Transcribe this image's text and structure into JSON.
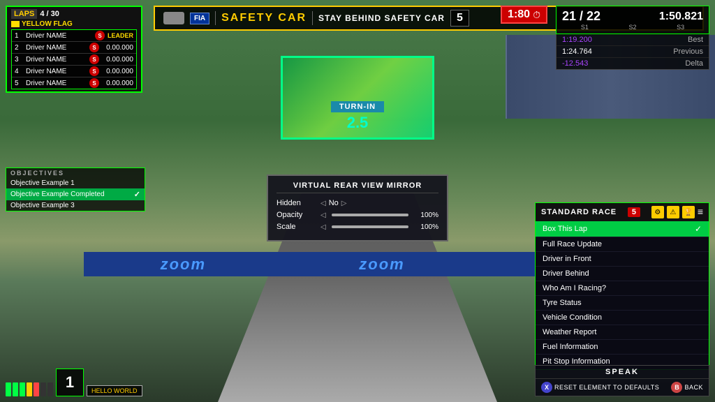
{
  "background": {
    "color": "#2a4a2a"
  },
  "timer": {
    "value": "1:80",
    "icon": "⏱"
  },
  "laps": {
    "label": "LAPS",
    "current": "4",
    "total": "30",
    "display": "4 / 30",
    "flag": "YELLOW FLAG"
  },
  "standings": [
    {
      "pos": "1",
      "name": "Driver NAME",
      "gap": "LEADER",
      "is_leader": true
    },
    {
      "pos": "2",
      "name": "Driver NAME",
      "gap": "0.00.000"
    },
    {
      "pos": "3",
      "name": "Driver NAME",
      "gap": "0.00.000"
    },
    {
      "pos": "4",
      "name": "Driver NAME",
      "gap": "0.00.000"
    },
    {
      "pos": "5",
      "name": "Driver NAME",
      "gap": "0.00.000"
    }
  ],
  "safety_car": {
    "fia": "FIA",
    "title": "SAFETY CAR",
    "instruction": "STAY BEHIND SAFETY CAR",
    "lap_num": "5"
  },
  "timing": {
    "position": "21 / 22",
    "lap_time": "1:50.821",
    "s1": "S1",
    "s2": "S2",
    "s3": "S3",
    "best": "1:19.200",
    "best_label": "Best",
    "previous": "1:24.764",
    "previous_label": "Previous",
    "delta": "-12.543",
    "delta_label": "Delta"
  },
  "turn_in": {
    "label": "TURN-IN",
    "value": "2.5"
  },
  "objectives": {
    "header": "OBJECTIVES",
    "items": [
      {
        "text": "Objective Example 1",
        "completed": false
      },
      {
        "text": "Objective Example Completed",
        "completed": true
      },
      {
        "text": "Objective Example 3",
        "completed": false
      }
    ]
  },
  "mirror_popup": {
    "title": "VIRTUAL REAR VIEW MIRROR",
    "hidden_label": "Hidden",
    "hidden_toggle": "<>",
    "hidden_value": "No",
    "opacity_label": "Opacity",
    "opacity_pct": "100%",
    "scale_label": "Scale",
    "scale_pct": "100%"
  },
  "race_panel": {
    "title": "STANDARD RACE",
    "badge": "5",
    "menu_items": [
      {
        "text": "Box This Lap",
        "active": true
      },
      {
        "text": "Full Race Update",
        "active": false
      },
      {
        "text": "Driver in Front",
        "active": false
      },
      {
        "text": "Driver Behind",
        "active": false
      },
      {
        "text": "Who Am I Racing?",
        "active": false
      },
      {
        "text": "Tyre Status",
        "active": false
      },
      {
        "text": "Vehicle Condition",
        "active": false
      },
      {
        "text": "Weather Report",
        "active": false
      },
      {
        "text": "Fuel Information",
        "active": false
      },
      {
        "text": "Pit Stop Information",
        "active": false
      }
    ]
  },
  "speak_bar": {
    "title": "SPEAK",
    "reset_label": "RESET ELEMENT TO DEFAULTS",
    "back_label": "BACK",
    "x_btn": "X",
    "b_btn": "B"
  },
  "hello_world": {
    "text": "HELLO WORLD"
  },
  "gear": {
    "value": "1"
  }
}
